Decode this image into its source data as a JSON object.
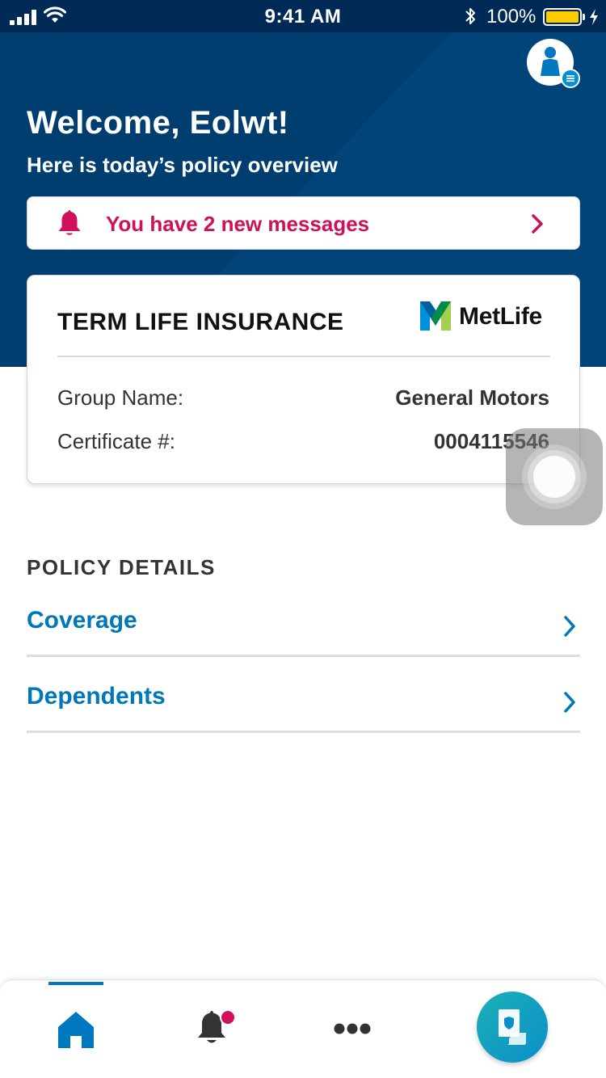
{
  "status_bar": {
    "time": "9:41 AM",
    "battery_percent": "100%",
    "battery_level": 1.0,
    "battery_color": "#ffcc00"
  },
  "header": {
    "welcome_title": "Welcome, Eolwt!",
    "welcome_subtitle": "Here is today’s policy overview",
    "background_color": "#003e70",
    "avatar_icon": "user-profile-icon",
    "avatar_badge_icon": "menu-lines-icon"
  },
  "messages_banner": {
    "text": "You have 2 new messages",
    "icon": "bell-icon",
    "accent_color": "#d0105a"
  },
  "policy_card": {
    "title": "TERM LIFE INSURANCE",
    "brand_name": "MetLife",
    "rows": [
      {
        "label": "Group Name:",
        "value": "General Motors"
      },
      {
        "label": "Certificate #:",
        "value": "0004115546"
      }
    ]
  },
  "policy_details": {
    "heading": "POLICY DETAILS",
    "items": [
      {
        "label": "Coverage"
      },
      {
        "label": "Dependents"
      }
    ],
    "link_color": "#0078b8"
  },
  "tab_bar": {
    "active_tab": "home",
    "tabs": [
      {
        "id": "home",
        "icon": "home-icon"
      },
      {
        "id": "notifications",
        "icon": "bell-icon",
        "has_badge": true
      },
      {
        "id": "more",
        "icon": "more-dots-icon"
      },
      {
        "id": "policy",
        "icon": "policy-document-icon"
      }
    ]
  }
}
